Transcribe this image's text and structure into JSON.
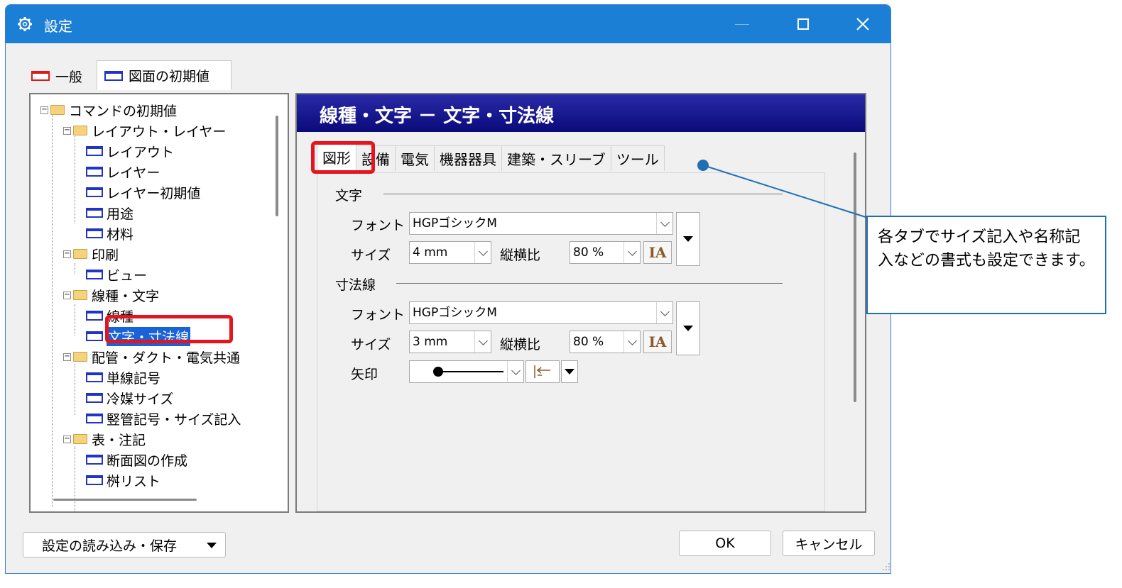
{
  "window": {
    "title": "設定"
  },
  "top_tabs": [
    "一般",
    "図面の初期値"
  ],
  "tree": [
    {
      "label": "コマンドの初期値"
    },
    {
      "label": "レイアウト・レイヤー"
    },
    {
      "label": "レイアウト"
    },
    {
      "label": "レイヤー"
    },
    {
      "label": "レイヤー初期値"
    },
    {
      "label": "用途"
    },
    {
      "label": "材料"
    },
    {
      "label": "印刷"
    },
    {
      "label": "ビュー"
    },
    {
      "label": "線種・文字"
    },
    {
      "label": "線種"
    },
    {
      "label": "文字・寸法線"
    },
    {
      "label": "配管・ダクト・電気共通"
    },
    {
      "label": "単線記号"
    },
    {
      "label": "冷媒サイズ"
    },
    {
      "label": "竪管記号・サイズ記入"
    },
    {
      "label": "表・注記"
    },
    {
      "label": "断面図の作成"
    },
    {
      "label": "桝リスト"
    }
  ],
  "panel": {
    "header": "線種・文字 － 文字・寸法線",
    "tabs": [
      "図形",
      "設備",
      "電気",
      "機器器具",
      "建築・スリーブ",
      "ツール"
    ],
    "text_section": {
      "title": "文字",
      "font_label": "フォント",
      "font_value": "HGPゴシックM",
      "size_label": "サイズ",
      "size_value": "4 mm",
      "ratio_label": "縦横比",
      "ratio_value": "80 %"
    },
    "dim_section": {
      "title": "寸法線",
      "font_label": "フォント",
      "font_value": "HGPゴシックM",
      "size_label": "サイズ",
      "size_value": "3 mm",
      "ratio_label": "縦横比",
      "ratio_value": "80 %",
      "arrow_label": "矢印"
    }
  },
  "buttons": {
    "load_save": "設定の読み込み・保存",
    "ok": "OK",
    "cancel": "キャンセル"
  },
  "callout": {
    "text": "各タブでサイズ記入や名称記入などの書式も設定できます。"
  },
  "colors": {
    "titlebar": "#1c7fd6",
    "panel_header": "#0a0a7a",
    "highlight": "#e5141e",
    "selection": "#1863d8"
  }
}
